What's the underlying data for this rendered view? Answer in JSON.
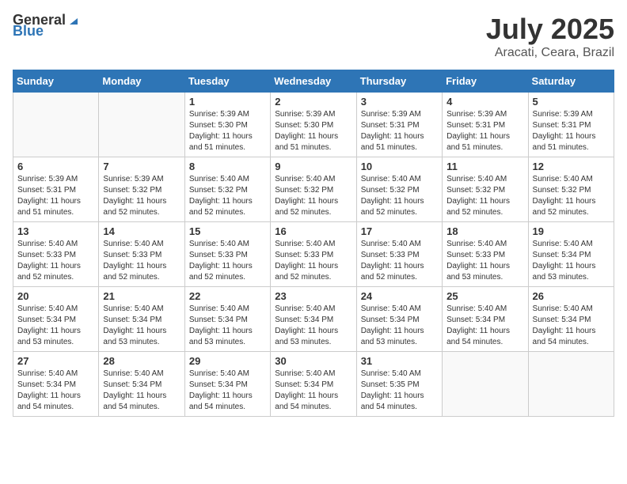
{
  "header": {
    "logo_general": "General",
    "logo_blue": "Blue",
    "title": "July 2025",
    "location": "Aracati, Ceara, Brazil"
  },
  "days_of_week": [
    "Sunday",
    "Monday",
    "Tuesday",
    "Wednesday",
    "Thursday",
    "Friday",
    "Saturday"
  ],
  "weeks": [
    [
      {
        "day": "",
        "info": ""
      },
      {
        "day": "",
        "info": ""
      },
      {
        "day": "1",
        "info": "Sunrise: 5:39 AM\nSunset: 5:30 PM\nDaylight: 11 hours and 51 minutes."
      },
      {
        "day": "2",
        "info": "Sunrise: 5:39 AM\nSunset: 5:30 PM\nDaylight: 11 hours and 51 minutes."
      },
      {
        "day": "3",
        "info": "Sunrise: 5:39 AM\nSunset: 5:31 PM\nDaylight: 11 hours and 51 minutes."
      },
      {
        "day": "4",
        "info": "Sunrise: 5:39 AM\nSunset: 5:31 PM\nDaylight: 11 hours and 51 minutes."
      },
      {
        "day": "5",
        "info": "Sunrise: 5:39 AM\nSunset: 5:31 PM\nDaylight: 11 hours and 51 minutes."
      }
    ],
    [
      {
        "day": "6",
        "info": "Sunrise: 5:39 AM\nSunset: 5:31 PM\nDaylight: 11 hours and 51 minutes."
      },
      {
        "day": "7",
        "info": "Sunrise: 5:39 AM\nSunset: 5:32 PM\nDaylight: 11 hours and 52 minutes."
      },
      {
        "day": "8",
        "info": "Sunrise: 5:40 AM\nSunset: 5:32 PM\nDaylight: 11 hours and 52 minutes."
      },
      {
        "day": "9",
        "info": "Sunrise: 5:40 AM\nSunset: 5:32 PM\nDaylight: 11 hours and 52 minutes."
      },
      {
        "day": "10",
        "info": "Sunrise: 5:40 AM\nSunset: 5:32 PM\nDaylight: 11 hours and 52 minutes."
      },
      {
        "day": "11",
        "info": "Sunrise: 5:40 AM\nSunset: 5:32 PM\nDaylight: 11 hours and 52 minutes."
      },
      {
        "day": "12",
        "info": "Sunrise: 5:40 AM\nSunset: 5:32 PM\nDaylight: 11 hours and 52 minutes."
      }
    ],
    [
      {
        "day": "13",
        "info": "Sunrise: 5:40 AM\nSunset: 5:33 PM\nDaylight: 11 hours and 52 minutes."
      },
      {
        "day": "14",
        "info": "Sunrise: 5:40 AM\nSunset: 5:33 PM\nDaylight: 11 hours and 52 minutes."
      },
      {
        "day": "15",
        "info": "Sunrise: 5:40 AM\nSunset: 5:33 PM\nDaylight: 11 hours and 52 minutes."
      },
      {
        "day": "16",
        "info": "Sunrise: 5:40 AM\nSunset: 5:33 PM\nDaylight: 11 hours and 52 minutes."
      },
      {
        "day": "17",
        "info": "Sunrise: 5:40 AM\nSunset: 5:33 PM\nDaylight: 11 hours and 52 minutes."
      },
      {
        "day": "18",
        "info": "Sunrise: 5:40 AM\nSunset: 5:33 PM\nDaylight: 11 hours and 53 minutes."
      },
      {
        "day": "19",
        "info": "Sunrise: 5:40 AM\nSunset: 5:34 PM\nDaylight: 11 hours and 53 minutes."
      }
    ],
    [
      {
        "day": "20",
        "info": "Sunrise: 5:40 AM\nSunset: 5:34 PM\nDaylight: 11 hours and 53 minutes."
      },
      {
        "day": "21",
        "info": "Sunrise: 5:40 AM\nSunset: 5:34 PM\nDaylight: 11 hours and 53 minutes."
      },
      {
        "day": "22",
        "info": "Sunrise: 5:40 AM\nSunset: 5:34 PM\nDaylight: 11 hours and 53 minutes."
      },
      {
        "day": "23",
        "info": "Sunrise: 5:40 AM\nSunset: 5:34 PM\nDaylight: 11 hours and 53 minutes."
      },
      {
        "day": "24",
        "info": "Sunrise: 5:40 AM\nSunset: 5:34 PM\nDaylight: 11 hours and 53 minutes."
      },
      {
        "day": "25",
        "info": "Sunrise: 5:40 AM\nSunset: 5:34 PM\nDaylight: 11 hours and 54 minutes."
      },
      {
        "day": "26",
        "info": "Sunrise: 5:40 AM\nSunset: 5:34 PM\nDaylight: 11 hours and 54 minutes."
      }
    ],
    [
      {
        "day": "27",
        "info": "Sunrise: 5:40 AM\nSunset: 5:34 PM\nDaylight: 11 hours and 54 minutes."
      },
      {
        "day": "28",
        "info": "Sunrise: 5:40 AM\nSunset: 5:34 PM\nDaylight: 11 hours and 54 minutes."
      },
      {
        "day": "29",
        "info": "Sunrise: 5:40 AM\nSunset: 5:34 PM\nDaylight: 11 hours and 54 minutes."
      },
      {
        "day": "30",
        "info": "Sunrise: 5:40 AM\nSunset: 5:34 PM\nDaylight: 11 hours and 54 minutes."
      },
      {
        "day": "31",
        "info": "Sunrise: 5:40 AM\nSunset: 5:35 PM\nDaylight: 11 hours and 54 minutes."
      },
      {
        "day": "",
        "info": ""
      },
      {
        "day": "",
        "info": ""
      }
    ]
  ]
}
